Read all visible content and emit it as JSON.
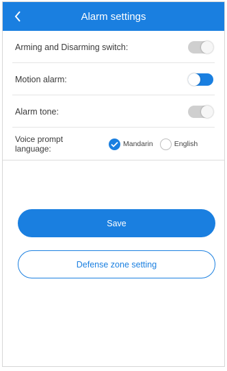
{
  "header": {
    "title": "Alarm settings",
    "back_icon": "chevron-left-icon"
  },
  "settings": {
    "arming_label": "Arming and Disarming switch:",
    "arming_on": false,
    "motion_label": "Motion alarm:",
    "motion_on": true,
    "tone_label": "Alarm tone:",
    "tone_on": false,
    "voice_label": "Voice prompt language:",
    "voice_options": [
      "Mandarin",
      "English"
    ],
    "voice_selected": "Mandarin"
  },
  "actions": {
    "save_label": "Save",
    "defense_label": "Defense zone setting"
  },
  "colors": {
    "accent": "#1a7fe0",
    "toggle_off": "#cfcfcf"
  }
}
